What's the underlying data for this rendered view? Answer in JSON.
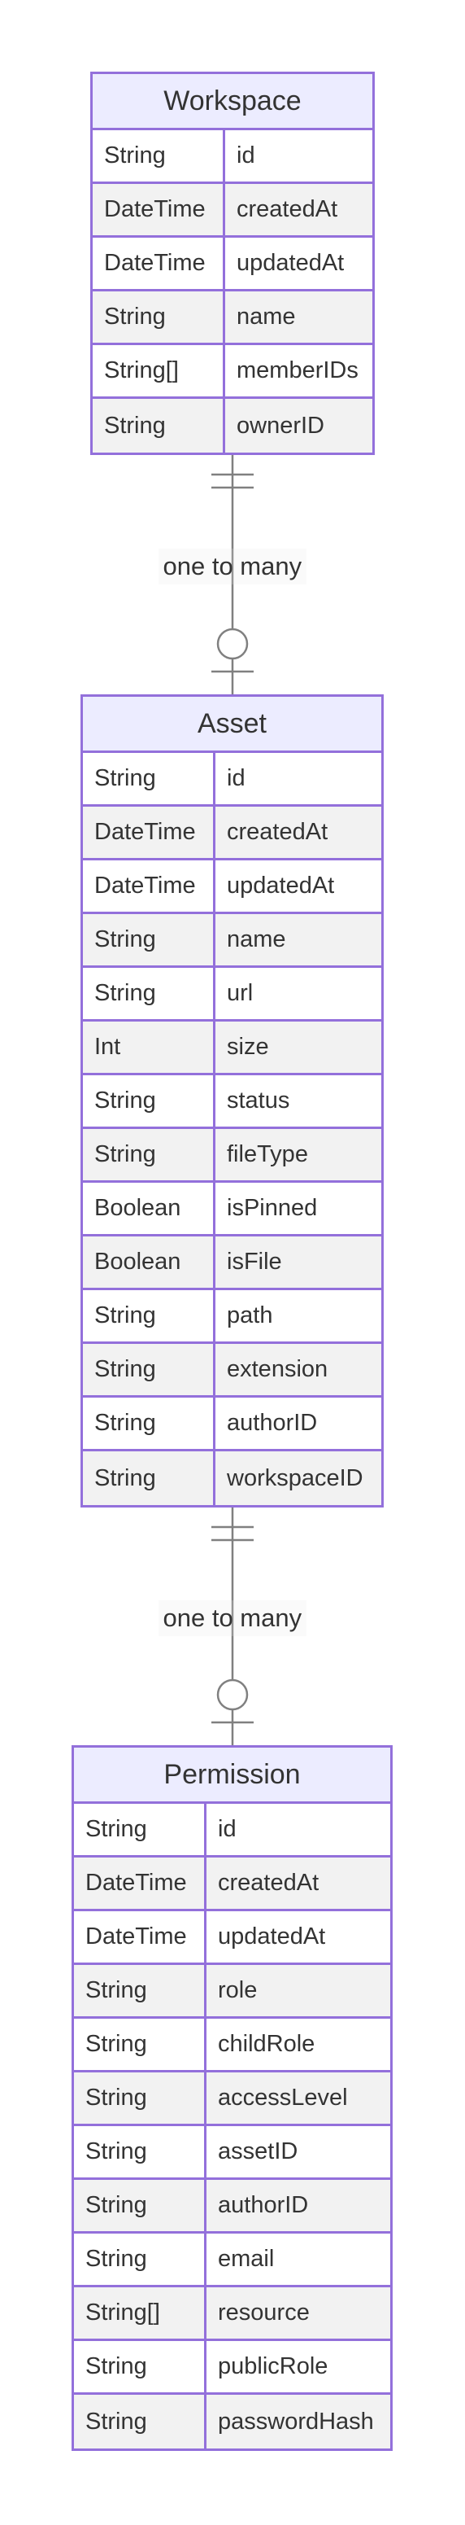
{
  "diagram": {
    "entities": [
      {
        "id": "workspace",
        "title": "Workspace",
        "attributes": [
          {
            "type": "String",
            "name": "id"
          },
          {
            "type": "DateTime",
            "name": "createdAt"
          },
          {
            "type": "DateTime",
            "name": "updatedAt"
          },
          {
            "type": "String",
            "name": "name"
          },
          {
            "type": "String[]",
            "name": "memberIDs"
          },
          {
            "type": "String",
            "name": "ownerID"
          }
        ]
      },
      {
        "id": "asset",
        "title": "Asset",
        "attributes": [
          {
            "type": "String",
            "name": "id"
          },
          {
            "type": "DateTime",
            "name": "createdAt"
          },
          {
            "type": "DateTime",
            "name": "updatedAt"
          },
          {
            "type": "String",
            "name": "name"
          },
          {
            "type": "String",
            "name": "url"
          },
          {
            "type": "Int",
            "name": "size"
          },
          {
            "type": "String",
            "name": "status"
          },
          {
            "type": "String",
            "name": "fileType"
          },
          {
            "type": "Boolean",
            "name": "isPinned"
          },
          {
            "type": "Boolean",
            "name": "isFile"
          },
          {
            "type": "String",
            "name": "path"
          },
          {
            "type": "String",
            "name": "extension"
          },
          {
            "type": "String",
            "name": "authorID"
          },
          {
            "type": "String",
            "name": "workspaceID"
          }
        ]
      },
      {
        "id": "permission",
        "title": "Permission",
        "attributes": [
          {
            "type": "String",
            "name": "id"
          },
          {
            "type": "DateTime",
            "name": "createdAt"
          },
          {
            "type": "DateTime",
            "name": "updatedAt"
          },
          {
            "type": "String",
            "name": "role"
          },
          {
            "type": "String",
            "name": "childRole"
          },
          {
            "type": "String",
            "name": "accessLevel"
          },
          {
            "type": "String",
            "name": "assetID"
          },
          {
            "type": "String",
            "name": "authorID"
          },
          {
            "type": "String",
            "name": "email"
          },
          {
            "type": "String[]",
            "name": "resource"
          },
          {
            "type": "String",
            "name": "publicRole"
          },
          {
            "type": "String",
            "name": "passwordHash"
          }
        ]
      }
    ],
    "relationships": [
      {
        "from": "workspace",
        "to": "asset",
        "label": "one to many",
        "from_cardinality": "exactly-one",
        "to_cardinality": "zero-or-many"
      },
      {
        "from": "asset",
        "to": "permission",
        "label": "one to many",
        "from_cardinality": "exactly-one",
        "to_cardinality": "zero-or-many"
      }
    ],
    "colors": {
      "border": "#9370db",
      "header_bg": "#ececff",
      "row_alt_bg": "#f2f2f2",
      "row_bg": "#ffffff",
      "line": "#808080",
      "text": "#333333"
    }
  }
}
